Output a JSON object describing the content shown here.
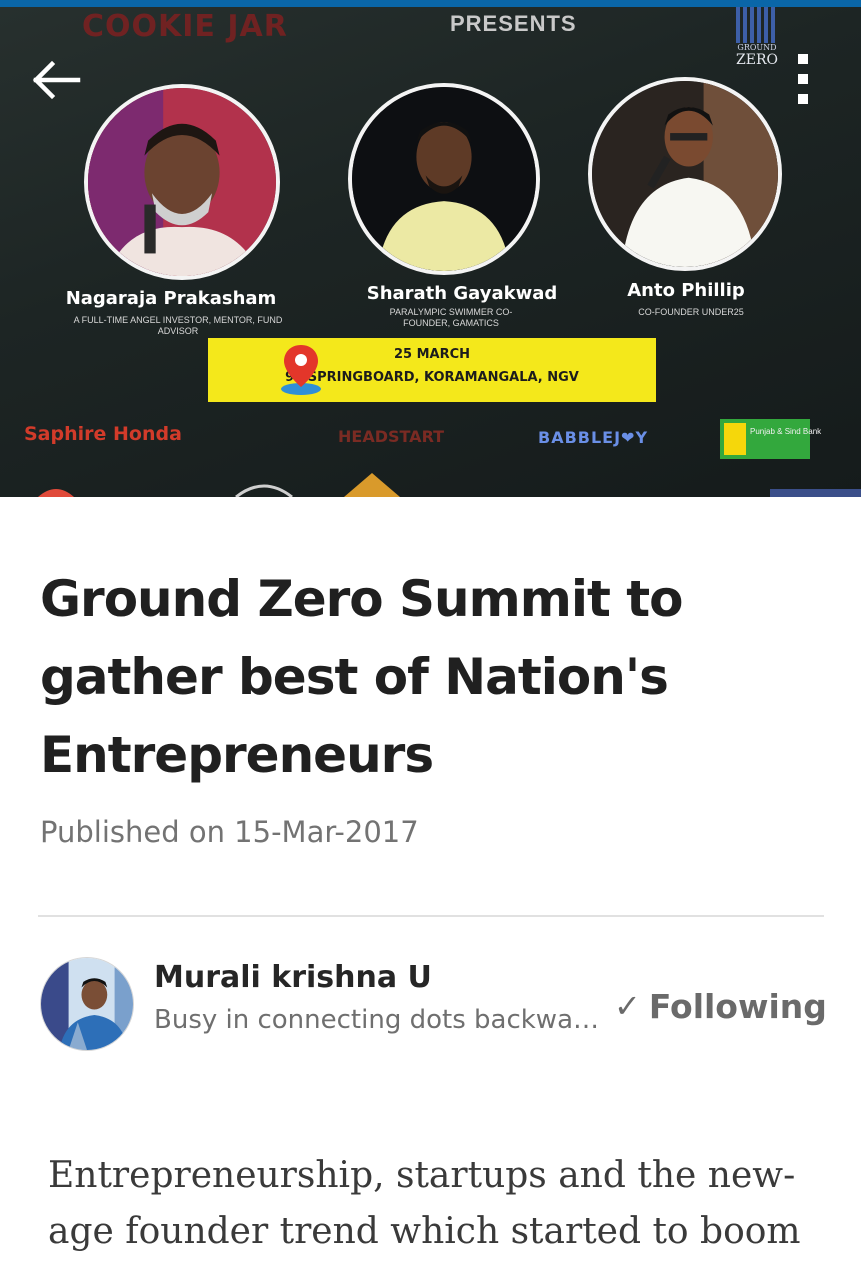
{
  "hero": {
    "brand_text": "COOKIE JAR",
    "presents": "PRESENTS",
    "event_logo": {
      "small": "GROUND",
      "big": "ZERO"
    },
    "speakers": [
      {
        "name": "Nagaraja Prakasham",
        "role": "A FULL-TIME ANGEL INVESTOR, MENTOR, FUND ADVISOR"
      },
      {
        "name": "Sharath Gayakwad",
        "role": "PARALYMPIC SWIMMER CO-FOUNDER, GAMATICS"
      },
      {
        "name": "Anto Phillip",
        "role": "CO-FOUNDER UNDER25"
      }
    ],
    "venue": {
      "date": "25 MARCH",
      "place": "91 SPRINGBOARD, KORAMANGALA, NGV"
    },
    "sponsors": {
      "honda": "Saphire Honda",
      "headstart": "HEADSTART",
      "babble": "BABBLEJ❤Y",
      "bank": "Punjab & Sind Bank"
    },
    "back_icon": "arrow-left-icon",
    "more_icon": "vertical-ellipsis-icon"
  },
  "article": {
    "title": "Ground Zero Summit to gather best of Nation's Entrepreneurs",
    "published": "Published on 15-Mar-2017",
    "body": "Entrepreneurship, startups and the new-age founder trend which started to boom"
  },
  "author": {
    "name": "Murali krishna U",
    "headline": "Busy in connecting dots backwards",
    "follow_check": "✓",
    "follow_label": "Following"
  },
  "colors": {
    "top_strip": "#0a66a8",
    "venue_yellow": "#f4e81b",
    "title_text": "#202020",
    "muted_text": "#737373"
  }
}
